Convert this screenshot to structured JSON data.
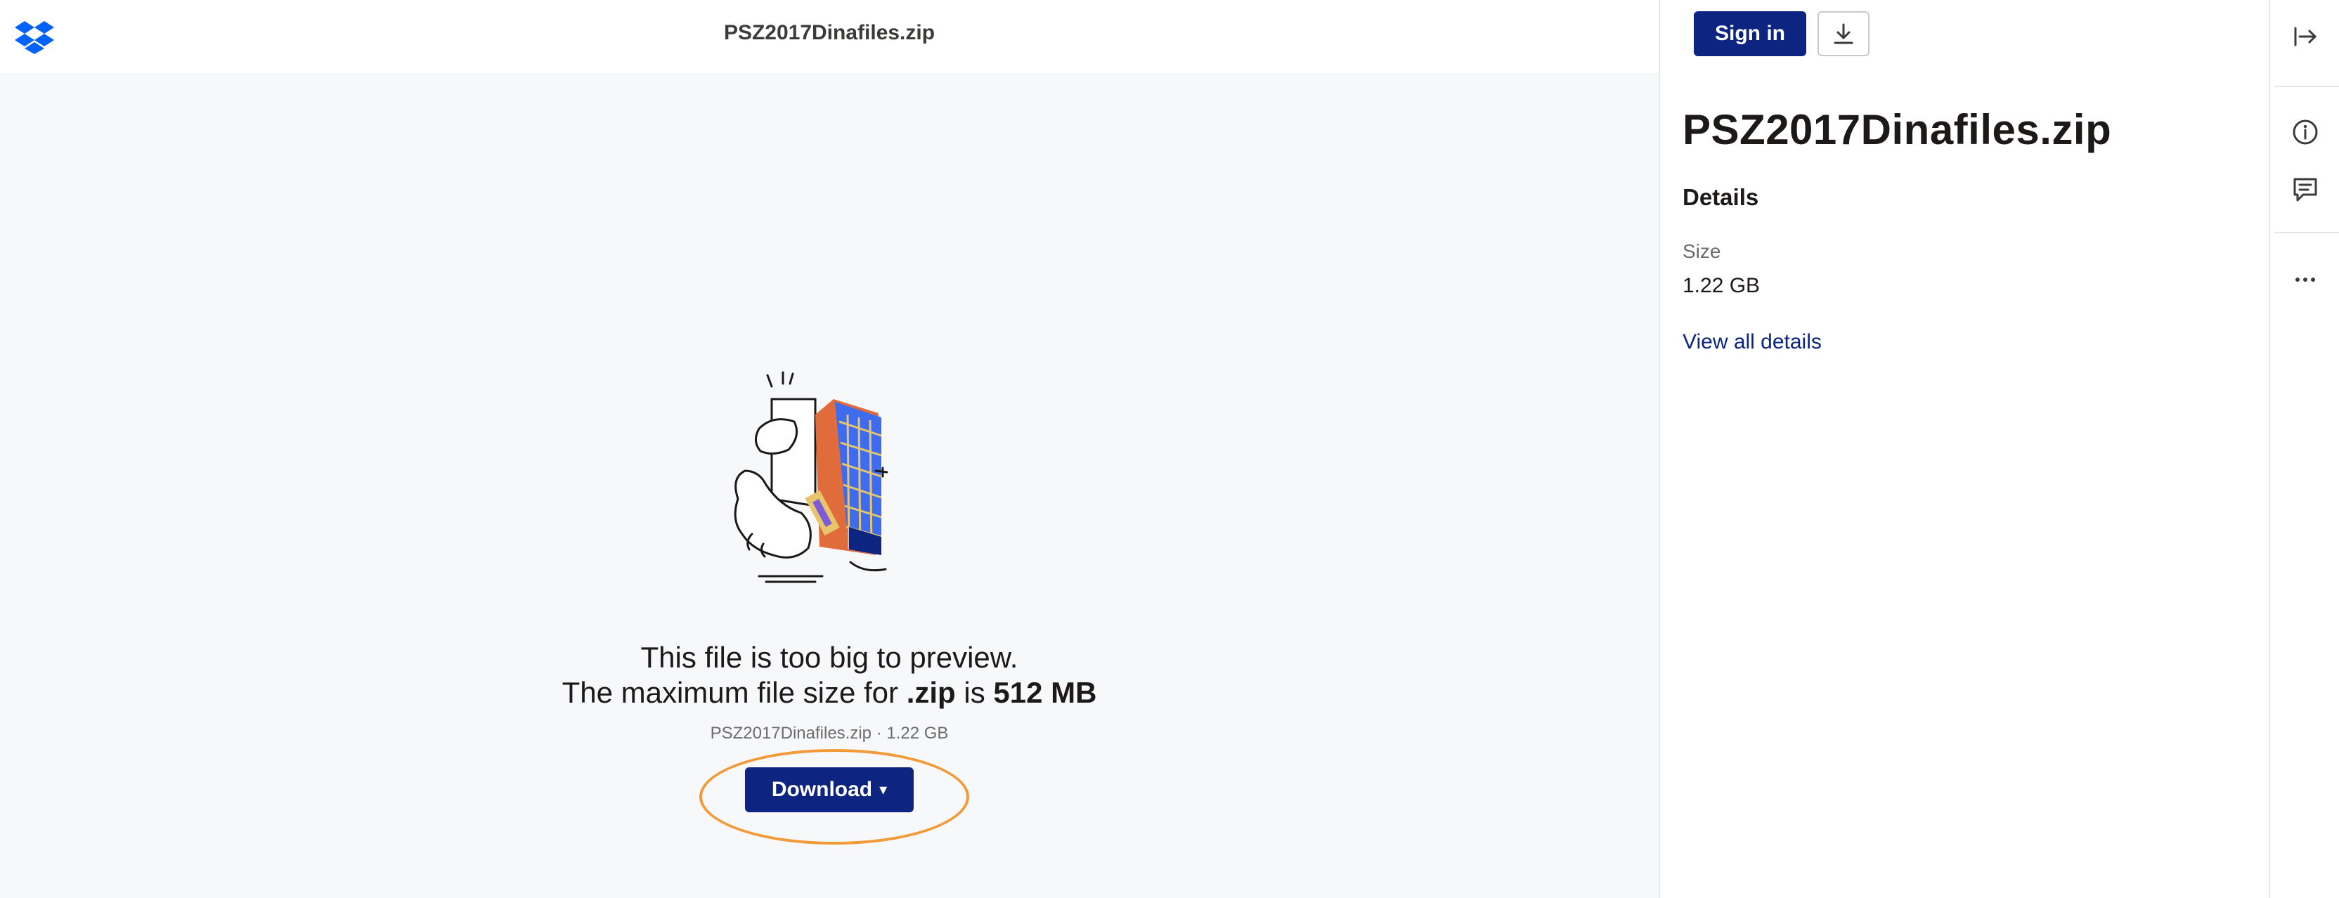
{
  "viewer": {
    "file_title": "PSZ2017Dinafiles.zip",
    "message_line1": "This file is too big to preview.",
    "message_line2_prefix": "The maximum file size for ",
    "message_line2_ext": ".zip",
    "message_line2_mid": " is ",
    "message_line2_limit": "512 MB",
    "file_meta": "PSZ2017Dinafiles.zip · 1.22 GB",
    "download_label": "Download",
    "download_caret": "▾"
  },
  "sidepanel": {
    "signin_label": "Sign in",
    "title": "PSZ2017Dinafiles.zip",
    "details_heading": "Details",
    "size_label": "Size",
    "size_value": "1.22 GB",
    "view_all_label": "View all details"
  },
  "icons": {
    "logo": "dropbox-logo",
    "download": "download-icon",
    "collapse": "collapse-panel-icon",
    "info": "info-icon",
    "comment": "comment-icon",
    "more": "more-icon"
  },
  "colors": {
    "brand": "#0061fe",
    "primary_button": "#0d2481",
    "highlight": "#f29a38",
    "viewer_bg": "#f7f8fa"
  }
}
